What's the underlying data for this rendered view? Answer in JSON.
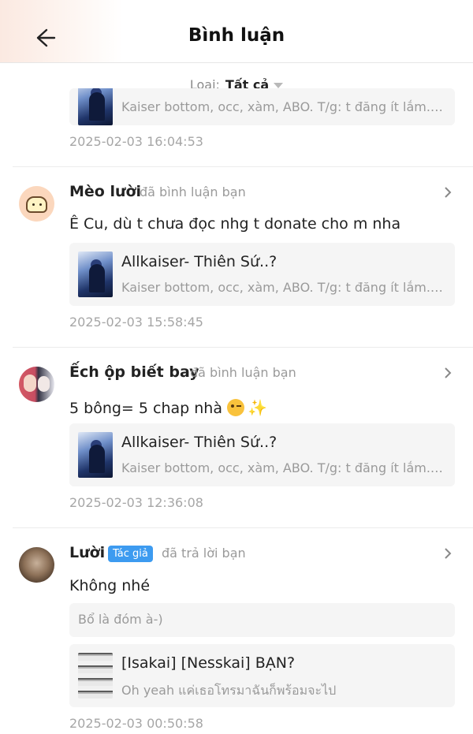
{
  "header": {
    "title": "Bình luận"
  },
  "filter": {
    "label": "Loại:",
    "value": "Tất cả"
  },
  "top_partial": {
    "card_sub": "Kaiser bottom, occ, xàm, ABO. T/g: t đăng ít lắm..ko...",
    "time": "2025-02-03 16:04:53"
  },
  "items": [
    {
      "user": "Mèo lười",
      "action": "đã bình luận bạn",
      "comment": "Ê Cu, dù t chưa đọc nhg t donate cho m nha",
      "card_title": "Allkaiser- Thiên Sứ..?",
      "card_sub": "Kaiser bottom, occ, xàm, ABO. T/g: t đăng ít lắm..ko...",
      "time": "2025-02-03 15:58:45"
    },
    {
      "user": "Ếch ộp biết bay",
      "action": "đã bình luận bạn",
      "comment": "5 bông= 5 chap nhà",
      "card_title": "Allkaiser- Thiên Sứ..?",
      "card_sub": "Kaiser bottom, occ, xàm, ABO. T/g: t đăng ít lắm..ko...",
      "time": "2025-02-03 12:36:08"
    },
    {
      "user": "Lười",
      "badge": "Tác giả",
      "action": "đã trả lời bạn",
      "comment": "Không nhé",
      "quoted": "Bổ là đóm à-)",
      "card_title": "[Isakai] [Nesskai] BẠN?",
      "card_sub": "Oh yeah แค่เธอโทรมาฉันก็พร้อมจะไป",
      "time": "2025-02-03 00:50:58"
    }
  ],
  "icons": {
    "back": "arrow-left-icon",
    "chevron": "chevron-right-icon",
    "filter_caret": "caret-down-icon"
  }
}
